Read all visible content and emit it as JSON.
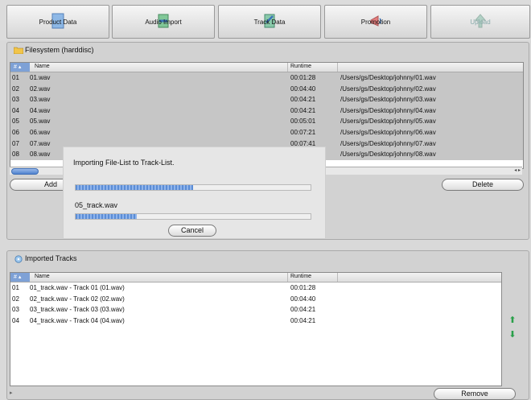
{
  "toolbar": {
    "product_data": "Product Data",
    "audio_import": "Audio Import",
    "track_data": "Track Data",
    "promotion": "Promotion",
    "upload": "Upload"
  },
  "filesystem": {
    "title": "Filesystem (harddisc)",
    "headers": {
      "num": "#",
      "name": "Name",
      "runtime": "Runtime"
    },
    "rows": [
      {
        "num": "01",
        "name": "01.wav",
        "runtime": "00:01:28",
        "path": "/Users/gs/Desktop/johnny/01.wav"
      },
      {
        "num": "02",
        "name": "02.wav",
        "runtime": "00:04:40",
        "path": "/Users/gs/Desktop/johnny/02.wav"
      },
      {
        "num": "03",
        "name": "03.wav",
        "runtime": "00:04:21",
        "path": "/Users/gs/Desktop/johnny/03.wav"
      },
      {
        "num": "04",
        "name": "04.wav",
        "runtime": "00:04:21",
        "path": "/Users/gs/Desktop/johnny/04.wav"
      },
      {
        "num": "05",
        "name": "05.wav",
        "runtime": "00:05:01",
        "path": "/Users/gs/Desktop/johnny/05.wav"
      },
      {
        "num": "06",
        "name": "06.wav",
        "runtime": "00:07:21",
        "path": "/Users/gs/Desktop/johnny/06.wav"
      },
      {
        "num": "07",
        "name": "07.wav",
        "runtime": "00:07:41",
        "path": "/Users/gs/Desktop/johnny/07.wav"
      },
      {
        "num": "08",
        "name": "08.wav",
        "runtime": "",
        "path": "/Users/gs/Desktop/johnny/08.wav"
      }
    ],
    "add_label": "Add",
    "delete_label": "Delete"
  },
  "dialog": {
    "message": "Importing File-List to Track-List.",
    "overall_progress": 0.5,
    "current_file": "05_track.wav",
    "file_progress": 0.26,
    "cancel_label": "Cancel"
  },
  "imported": {
    "title": "Imported Tracks",
    "headers": {
      "num": "#",
      "name": "Name",
      "runtime": "Runtime"
    },
    "rows": [
      {
        "num": "01",
        "name": "01_track.wav - Track 01 (01.wav)",
        "runtime": "00:01:28"
      },
      {
        "num": "02",
        "name": "02_track.wav - Track 02 (02.wav)",
        "runtime": "00:04:40"
      },
      {
        "num": "03",
        "name": "03_track.wav - Track 03 (03.wav)",
        "runtime": "00:04:21"
      },
      {
        "num": "04",
        "name": "04_track.wav - Track 04 (04.wav)",
        "runtime": "00:04:21"
      }
    ],
    "remove_label": "Remove"
  }
}
